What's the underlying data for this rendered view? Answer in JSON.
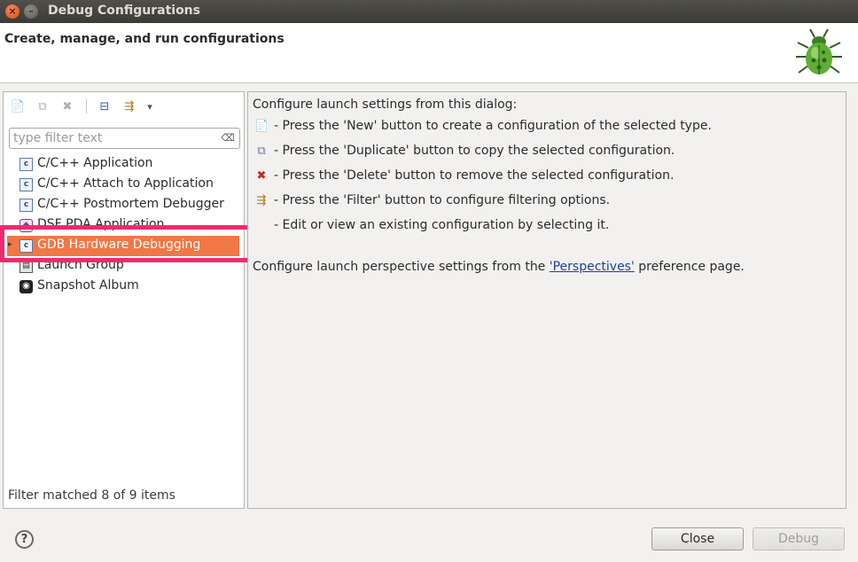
{
  "window": {
    "title": "Debug Configurations",
    "close_glyph": "×",
    "minimize_glyph": "–"
  },
  "banner": {
    "heading": "Create, manage, and run configurations"
  },
  "left": {
    "toolbar": [
      {
        "name": "new-configuration-icon",
        "glyph": "📄"
      },
      {
        "name": "duplicate-icon",
        "glyph": "⧉"
      },
      {
        "name": "delete-icon",
        "glyph": "✖"
      },
      {
        "name": "collapse-all-icon",
        "glyph": "⊟"
      },
      {
        "name": "filter-icon",
        "glyph": "⇶"
      },
      {
        "name": "view-menu-chevron-icon",
        "glyph": "▾"
      }
    ],
    "filter": {
      "placeholder": "type filter text",
      "clear_glyph": "⌫"
    },
    "tree": [
      {
        "label": "C/C++ Application",
        "icon": "c-config-icon",
        "glyph": "c"
      },
      {
        "label": "C/C++ Attach to Application",
        "icon": "c-config-icon",
        "glyph": "c"
      },
      {
        "label": "C/C++ Postmortem Debugger",
        "icon": "c-config-icon",
        "glyph": "c"
      },
      {
        "label": "DSF PDA Application",
        "icon": "pda-config-icon",
        "glyph": "◆"
      },
      {
        "label": "GDB Hardware Debugging",
        "icon": "c-config-icon",
        "glyph": "c",
        "selected": true,
        "expander": "▸"
      },
      {
        "label": "Launch Group",
        "icon": "launch-group-icon",
        "glyph": "▤"
      },
      {
        "label": "Snapshot Album",
        "icon": "camera-icon",
        "glyph": "◉"
      }
    ],
    "status": "Filter matched 8 of 9 items"
  },
  "right": {
    "intro": "Configure launch settings from this dialog:",
    "help_lines": [
      {
        "icon": "new-configuration-icon",
        "glyph": "📄",
        "text": "- Press the 'New' button to create a configuration of the selected type."
      },
      {
        "icon": "duplicate-icon",
        "glyph": "⧉",
        "text": "- Press the 'Duplicate' button to copy the selected configuration."
      },
      {
        "icon": "delete-icon",
        "glyph": "✖",
        "text": "- Press the 'Delete' button to remove the selected configuration."
      },
      {
        "icon": "filter-icon",
        "glyph": "⇶",
        "text": "- Press the 'Filter' button to configure filtering options."
      },
      {
        "icon": "",
        "glyph": "",
        "text": "- Edit or view an existing configuration by selecting it."
      }
    ],
    "perspectives_prefix": "Configure launch perspective settings from the ",
    "perspectives_link": "'Perspectives'",
    "perspectives_suffix": " preference page."
  },
  "footer": {
    "help_glyph": "?",
    "close_label": "Close",
    "debug_label": "Debug"
  },
  "colors": {
    "selection": "#f07746",
    "highlight_border": "#f02a6e",
    "link": "#1d3da0"
  }
}
